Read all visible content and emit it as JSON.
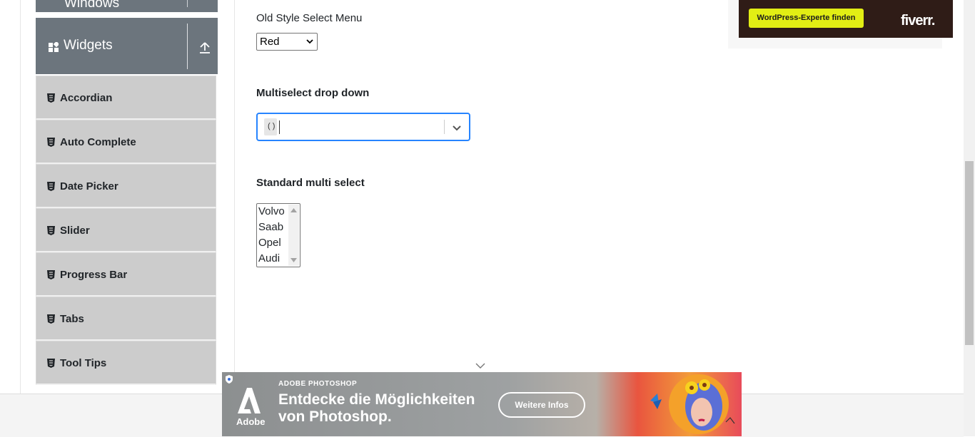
{
  "sidebar": {
    "windows_group": {
      "label": "Windows"
    },
    "widgets_group": {
      "label": "Widgets"
    },
    "items": [
      {
        "label": "Accordian"
      },
      {
        "label": "Auto Complete"
      },
      {
        "label": "Date Picker"
      },
      {
        "label": "Slider"
      },
      {
        "label": "Progress Bar"
      },
      {
        "label": "Tabs"
      },
      {
        "label": "Tool Tips"
      }
    ]
  },
  "main": {
    "old_select": {
      "label": "Old Style Select Menu",
      "value": "Red"
    },
    "multiselect": {
      "label": "Multiselect drop down",
      "chip_text": "( )"
    },
    "standard_multi": {
      "label": "Standard multi select",
      "options": [
        "Volvo",
        "Saab",
        "Opel",
        "Audi"
      ]
    }
  },
  "ads": {
    "top": {
      "cta": "WordPress-Experte finden",
      "brand": "fiverr."
    },
    "bottom": {
      "eyebrow": "ADOBE PHOTOSHOP",
      "headline_line1": "Entdecke die Möglichkeiten",
      "headline_line2": "von Photoshop.",
      "button": "Weitere Infos",
      "logo_text": "Adobe"
    }
  },
  "colors": {
    "sidebar_header_bg": "#6c757d",
    "menu_item_bg": "#cccccc",
    "focus_border": "#2684ff",
    "fiverr_cta": "#e2ee14"
  },
  "icons": {
    "widgets": "widgets-grid-icon",
    "collapse": "upload-arrow-icon",
    "menu_item": "html5-shield-icon",
    "dropdown": "chevron-down-icon"
  }
}
